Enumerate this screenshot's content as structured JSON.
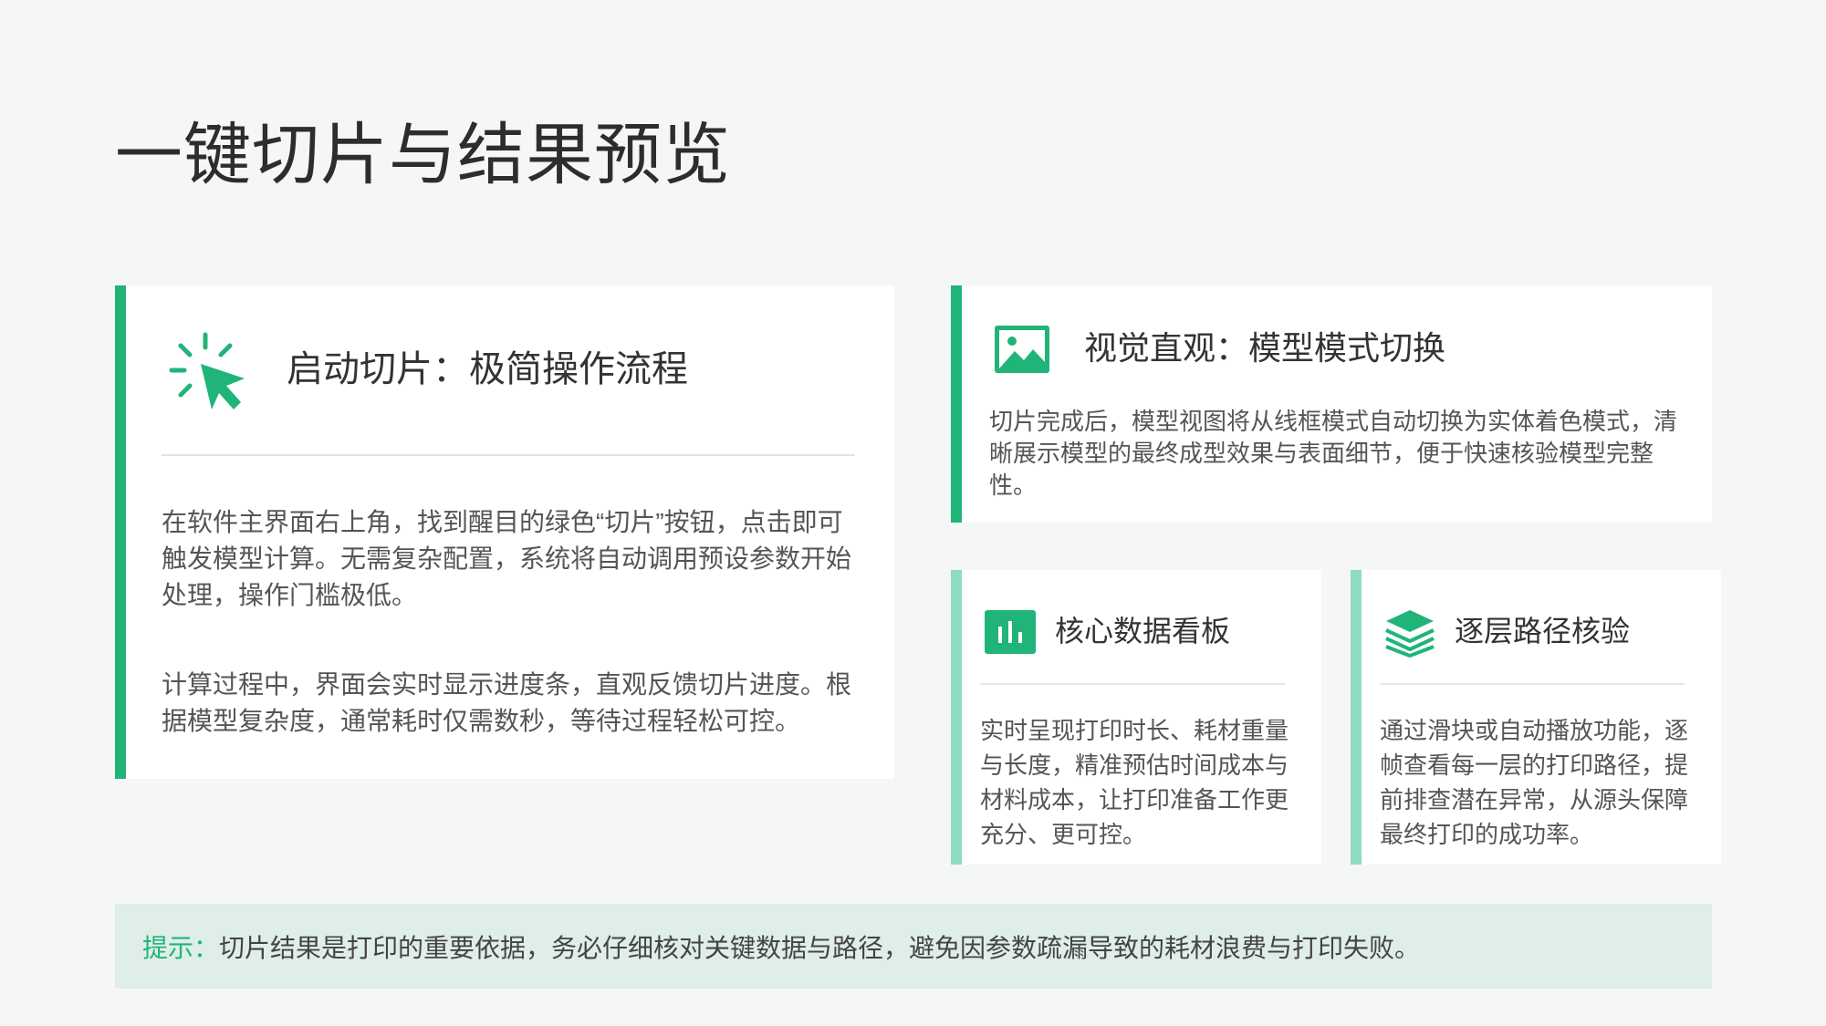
{
  "page": {
    "title": "一键切片与结果预览"
  },
  "colors": {
    "accent": "#21b479",
    "accent_light": "#8fdcc0",
    "tip_background": "#dfeee8",
    "page_background": "#f5f6f8"
  },
  "left_card": {
    "icon": "cursor-click-icon",
    "title": "启动切片：极简操作流程",
    "paragraph1": "在软件主界面右上角，找到醒目的绿色“切片”按钮，点击即可触发模型计算。无需复杂配置，系统将自动调用预设参数开始处理，操作门槛极低。",
    "paragraph2": "计算过程中，界面会实时显示进度条，直观反馈切片进度。根据模型复杂度，通常耗时仅需数秒，等待过程轻松可控。"
  },
  "top_right_card": {
    "icon": "image-icon",
    "title": "视觉直观：模型模式切换",
    "description": "切片完成后，模型视图将从线框模式自动切换为实体着色模式，清晰展示模型的最终成型效果与表面细节，便于快速核验模型完整性。"
  },
  "dashboard_card": {
    "icon": "bar-chart-icon",
    "title": "核心数据看板",
    "description": "实时呈现打印时长、耗材重量与长度，精准预估时间成本与材料成本，让打印准备工作更充分、更可控。"
  },
  "layers_card": {
    "icon": "layers-icon",
    "title": "逐层路径核验",
    "description": "通过滑块或自动播放功能，逐帧查看每一层的打印路径，提前排查潜在异常，从源头保障最终打印的成功率。"
  },
  "tip": {
    "label": "提示：",
    "text": "切片结果是打印的重要依据，务必仔细核对关键数据与路径，避免因参数疏漏导致的耗材浪费与打印失败。"
  }
}
